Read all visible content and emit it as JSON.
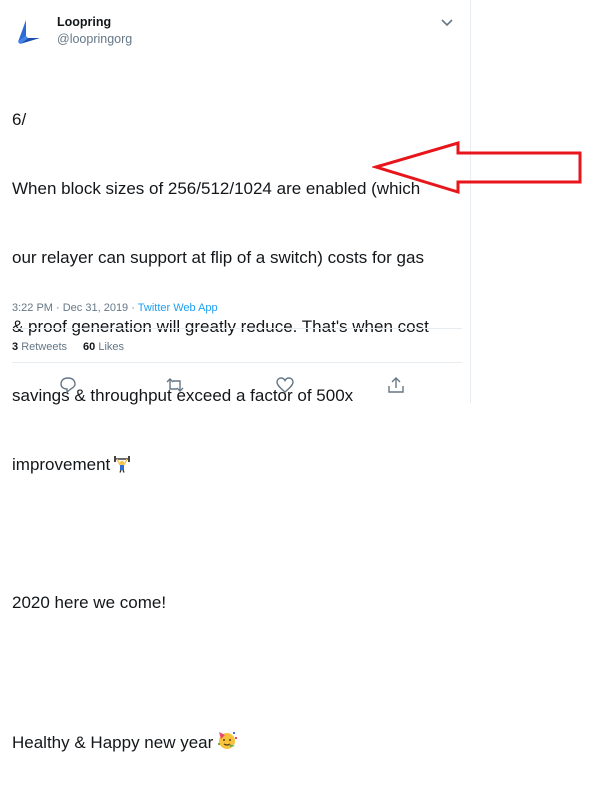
{
  "tweet": {
    "author_name": "Loopring",
    "author_handle": "@loopringorg",
    "text_lines": [
      "6/",
      "When block sizes of 256/512/1024 are enabled (which",
      "our relayer can support at flip of a switch) costs for gas",
      "& proof generation will greatly reduce. That's when cost",
      "savings & throughput exceed a factor of 500x",
      "improvement",
      "",
      "2020 here we come!",
      "",
      "Healthy & Happy new year"
    ],
    "timestamp": "3:22 PM · Dec 31, 2019",
    "separator": " · ",
    "source": "Twitter Web App",
    "retweets_count": "3",
    "retweets_label": "Retweets",
    "likes_count": "60",
    "likes_label": "Likes"
  },
  "icons": {
    "logo": "loopring-logo-icon",
    "menu": "chevron-down-icon",
    "weightlifter": "weightlifter-emoji-icon",
    "party": "partying-face-emoji-icon",
    "reply": "reply-icon",
    "retweet": "retweet-icon",
    "like": "heart-icon",
    "share": "share-icon",
    "annotation": "red-arrow-icon"
  },
  "colors": {
    "text": "#14171a",
    "muted": "#657786",
    "link": "#1da1f2",
    "logo": "#2a6bd6",
    "arrow": "#e8161b",
    "divider": "#e6ecf0"
  }
}
